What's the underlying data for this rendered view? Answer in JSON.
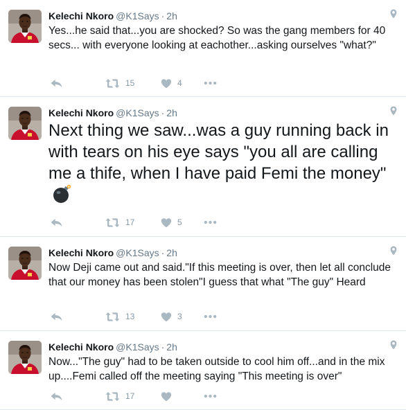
{
  "tweets": [
    {
      "name": "Kelechi Nkoro",
      "handle": "@K1Says",
      "separator": "·",
      "time": "2h",
      "text": "Yes...he said that...you are shocked?  So was the gang members for 40 secs... with everyone looking at eachother...asking ourselves \"what?\"",
      "retweets": "15",
      "likes": "4"
    },
    {
      "name": "Kelechi Nkoro",
      "handle": "@K1Says",
      "separator": "·",
      "time": "2h",
      "text": "Next thing we saw...was a guy running back in with tears on his eye says \"you all are calling me a thife, when I have paid Femi the money\"",
      "emoji": "bomb-emoji",
      "retweets": "17",
      "likes": "5"
    },
    {
      "name": "Kelechi Nkoro",
      "handle": "@K1Says",
      "separator": "·",
      "time": "2h",
      "text": "Now Deji came out and said.\"If this meeting is over, then let all conclude that our money has been stolen\"I guess that what \"The guy\" Heard",
      "retweets": "13",
      "likes": "3"
    },
    {
      "name": "Kelechi Nkoro",
      "handle": "@K1Says",
      "separator": "·",
      "time": "2h",
      "text": "Now...\"The guy\" had to be taken outside to cool him off...and in the mix up....Femi called off the meeting saying \"This meeting is over\"",
      "retweets": "17",
      "likes": ""
    }
  ],
  "icons": {
    "reply": "reply-icon",
    "retweet": "retweet-icon",
    "like": "heart-icon",
    "more": "more-icon",
    "location": "location-pin-icon"
  },
  "colors": {
    "icon": "#aab8c2",
    "count": "#8899a6",
    "secondary_text": "#657786",
    "divider": "#e1e8ed"
  }
}
